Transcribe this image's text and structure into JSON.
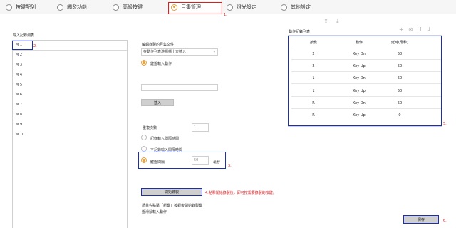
{
  "tabs": [
    {
      "label": "按鍵配列",
      "icon": "radio-icon"
    },
    {
      "label": "觸發功能",
      "icon": "radio-icon"
    },
    {
      "label": "高級按鍵",
      "icon": "radio-icon"
    },
    {
      "label": "巨集管理",
      "icon": "radio-icon",
      "active": true
    },
    {
      "label": "燈光設定",
      "icon": "radio-icon"
    },
    {
      "label": "其他設定",
      "icon": "radio-icon"
    }
  ],
  "annotations": {
    "n1": "1.",
    "n2": "2.",
    "n3": "3.",
    "n4": "4.點擊開始錄製後，即可按需要錄製的按鍵。",
    "n5": "5.",
    "n6": "6."
  },
  "left": {
    "title": "輸入記錄列表",
    "items": [
      "M 1",
      "M 2",
      "M 3",
      "M 4",
      "M 5",
      "M 6",
      "M 7",
      "M 8",
      "M 9",
      "M 10"
    ]
  },
  "middle": {
    "edit_title": "編輯錄製的巨集文件",
    "insert_select": "在動作列表游標標上方插入",
    "key_input_label": "鍵盤輸入動作",
    "insert_button": "插入",
    "repeat_label": "重複次數",
    "repeat_value": "1",
    "record_interval_label": "記錄輸入間隔時間",
    "no_record_interval_label": "不記錄輸入間隔時間",
    "fixed_interval_label": "鍵盤間隔",
    "fixed_interval_value": "50",
    "ms_label": "毫秒",
    "start_record_button": "開始錄製",
    "hint_line1": "請首先點擊「新鍵」按鈕後開始錄製鍵",
    "hint_line2": "盤滑鼠輸入動作"
  },
  "right": {
    "title": "動作記錄列表",
    "headers": [
      "按鍵",
      "動作",
      "延時(毫秒)"
    ],
    "rows": [
      [
        "2",
        "Key Dn",
        "50"
      ],
      [
        "2",
        "Key Up",
        "50"
      ],
      [
        "1",
        "Key Dn",
        "50"
      ],
      [
        "1",
        "Key Up",
        "50"
      ],
      [
        "R",
        "Key Dn",
        "50"
      ],
      [
        "R",
        "Key Up",
        "0"
      ]
    ],
    "toolbar_icons": [
      "upload-icon",
      "download-icon"
    ],
    "table_icons": [
      "add-icon",
      "delete-icon",
      "move-up-icon",
      "move-down-icon"
    ]
  },
  "save_button": "保存",
  "colors": {
    "accent": "#e8a03a",
    "highlight_red": "#e31b1b",
    "highlight_blue": "#1e2fa8"
  }
}
